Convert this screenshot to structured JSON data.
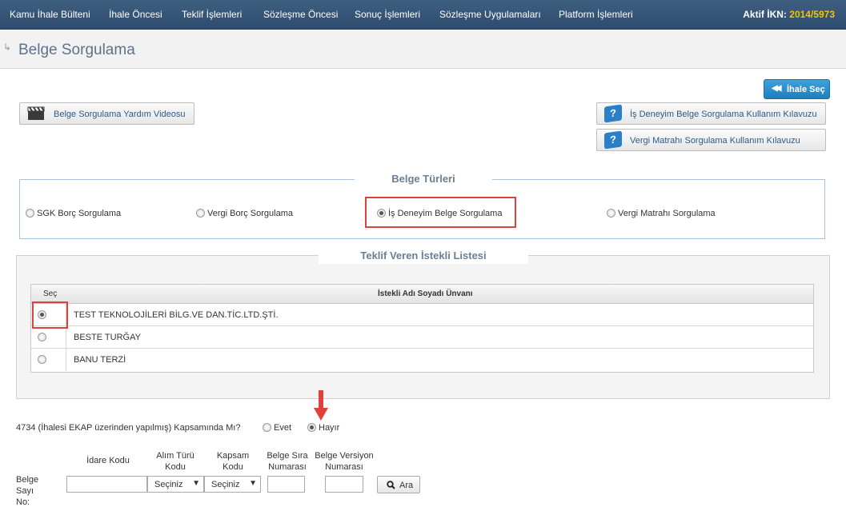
{
  "nav": {
    "items": [
      "Kamu İhale Bülteni",
      "İhale Öncesi",
      "Teklif İşlemleri",
      "Sözleşme Öncesi",
      "Sonuç İşlemleri",
      "Sözleşme Uygulamaları",
      "Platform İşlemleri"
    ],
    "ikn_label": "Aktif İKN: ",
    "ikn_value": "2014/5973"
  },
  "header": {
    "arrow": "↳",
    "title": "Belge Sorgulama"
  },
  "buttons": {
    "ihale_sec": "İhale Seç",
    "video": "Belge Sorgulama Yardım Videosu",
    "guide1": "İş Deneyim Belge Sorgulama Kullanım Kılavuzu",
    "guide2": "Vergi Matrahı Sorgulama Kullanım Kılavuzu",
    "ara": "Ara"
  },
  "belge_turleri": {
    "legend": "Belge Türleri",
    "options": [
      "SGK Borç Sorgulama",
      "Vergi Borç Sorgulama",
      "İş Deneyim Belge Sorgulama",
      "Vergi Matrahı Sorgulama"
    ],
    "selected": 2
  },
  "istekli": {
    "legend": "Teklif Veren İstekli Listesi",
    "col_sec": "Seç",
    "col_name": "İstekli Adı Soyadı Ünvanı",
    "rows": [
      "TEST TEKNOLOJİLERİ BİLG.VE DAN.TİC.LTD.ŞTİ.",
      "BESTE TURĞAY",
      "BANU TERZİ"
    ],
    "selected": 0
  },
  "question": {
    "text": "4734 (İhalesi EKAP üzerinden yapılmış) Kapsamında Mı?",
    "yes": "Evet",
    "no": "Hayır",
    "selected": "no"
  },
  "belge_no": {
    "label": "Belge Sayı No:",
    "col_idare": "İdare Kodu",
    "col_alim": "Alım Türü Kodu",
    "col_kapsam": "Kapsam Kodu",
    "col_sira": "Belge Sıra Numarası",
    "col_versiyon": "Belge Versiyon Numarası",
    "select_placeholder": "Seçiniz",
    "idare_value": "",
    "sira_value": "",
    "versiyon_value": ""
  },
  "colors": {
    "nav_bg": "#34547a",
    "accent": "#2a80c8",
    "highlight": "#e0423a",
    "ikn": "#f5c400"
  }
}
